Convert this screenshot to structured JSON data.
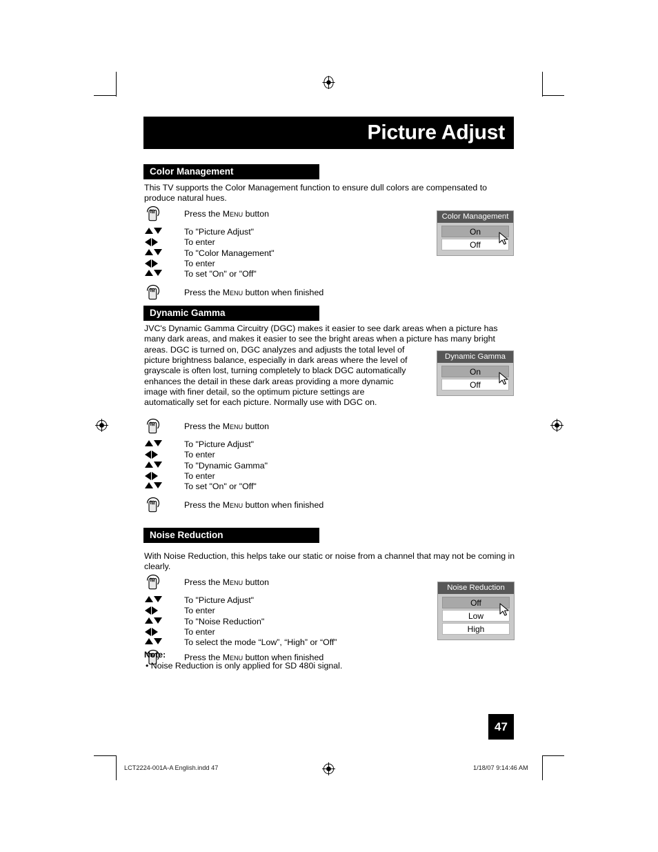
{
  "page": {
    "title": "Picture Adjust",
    "number": "47"
  },
  "sections": [
    {
      "heading": "Color Management",
      "paragraph": "This TV supports the Color Management function to ensure dull colors are compensated to produce natural hues.",
      "steps": [
        {
          "glyph": "hand-press-icon",
          "text_prefix": "Press the ",
          "text_caps": "Menu",
          "text_suffix": " button"
        },
        {
          "glyph": "up-down-arrows-icon",
          "text": "To \"Picture Adjust\""
        },
        {
          "glyph": "left-right-arrows-icon",
          "text": "To enter"
        },
        {
          "glyph": "up-down-arrows-icon",
          "text": "To \"Color Management\""
        },
        {
          "glyph": "left-right-arrows-icon",
          "text": "To enter"
        },
        {
          "glyph": "up-down-arrows-icon",
          "text": "To set \"On\" or \"Off\""
        },
        {
          "glyph": "hand-press-icon",
          "text_prefix": "Press the ",
          "text_caps": "Menu",
          "text_suffix": " button when finished"
        }
      ],
      "osd": {
        "title": "Color Management",
        "rows": [
          {
            "label": "On",
            "selected": true
          },
          {
            "label": "Off",
            "selected": false
          }
        ]
      }
    },
    {
      "heading": "Dynamic Gamma",
      "paragraph_full": "JVC's Dynamic Gamma Circuitry (DGC) makes it easier to see dark areas when a picture has many dark areas, and makes it easier to see the bright areas when a picture has many bright",
      "paragraph_narrow": "areas.  DGC is turned on, DGC analyzes and adjusts the total level of picture brightness balance, especially in dark areas where the level of grayscale is often lost, turning completely to black DGC automatically enhances the detail in these dark areas providing a more dynamic image with finer detail, so the optimum picture settings are automatically set for each picture.  Normally use with DGC on.",
      "steps": [
        {
          "glyph": "hand-press-icon",
          "text_prefix": "Press the ",
          "text_caps": "Menu",
          "text_suffix": " button"
        },
        {
          "glyph": "up-down-arrows-icon",
          "text": "To \"Picture Adjust\""
        },
        {
          "glyph": "left-right-arrows-icon",
          "text": "To enter"
        },
        {
          "glyph": "up-down-arrows-icon",
          "text": "To \"Dynamic Gamma\""
        },
        {
          "glyph": "left-right-arrows-icon",
          "text": "To enter"
        },
        {
          "glyph": "up-down-arrows-icon",
          "text": "To set \"On\" or \"Off\""
        },
        {
          "glyph": "hand-press-icon",
          "text_prefix": "Press the ",
          "text_caps": "Menu",
          "text_suffix": " button when finished"
        }
      ],
      "osd": {
        "title": "Dynamic Gamma",
        "rows": [
          {
            "label": "On",
            "selected": true
          },
          {
            "label": "Off",
            "selected": false
          }
        ]
      }
    },
    {
      "heading": "Noise Reduction",
      "paragraph": "With Noise Reduction, this helps take our static or noise from a channel that may not be coming in clearly.",
      "steps": [
        {
          "glyph": "hand-press-icon",
          "text_prefix": "Press the ",
          "text_caps": "Menu",
          "text_suffix": " button"
        },
        {
          "glyph": "up-down-arrows-icon",
          "text": "To \"Picture Adjust\""
        },
        {
          "glyph": "left-right-arrows-icon",
          "text": "To enter"
        },
        {
          "glyph": "up-down-arrows-icon",
          "text": "To \"Noise Reduction\""
        },
        {
          "glyph": "left-right-arrows-icon",
          "text": "To enter"
        },
        {
          "glyph": "up-down-arrows-icon",
          "text": "To select the mode “Low”, “High” or “Off”"
        },
        {
          "glyph": "hand-press-icon",
          "text_prefix": "Press the ",
          "text_caps": "Menu",
          "text_suffix": " button when finished"
        }
      ],
      "osd": {
        "title": "Noise Reduction",
        "rows": [
          {
            "label": "Off",
            "selected": true
          },
          {
            "label": "Low",
            "selected": false
          },
          {
            "label": "High",
            "selected": false
          }
        ]
      }
    }
  ],
  "note": {
    "label": "Note:",
    "items": [
      "•  Noise Reduction is only applied for SD 480i signal."
    ]
  },
  "footer": {
    "left": "LCT2224-001A-A English.indd   47",
    "right": "1/18/07   9:14:46 AM"
  },
  "colors": {
    "banner_bg": "#000000",
    "banner_text": "#ffffff",
    "osd_title_bg": "#575757",
    "osd_selected_bg": "#a8a8a8",
    "osd_frame_bg": "#c9c9c9",
    "osd_row_bg": "#ffffff"
  }
}
